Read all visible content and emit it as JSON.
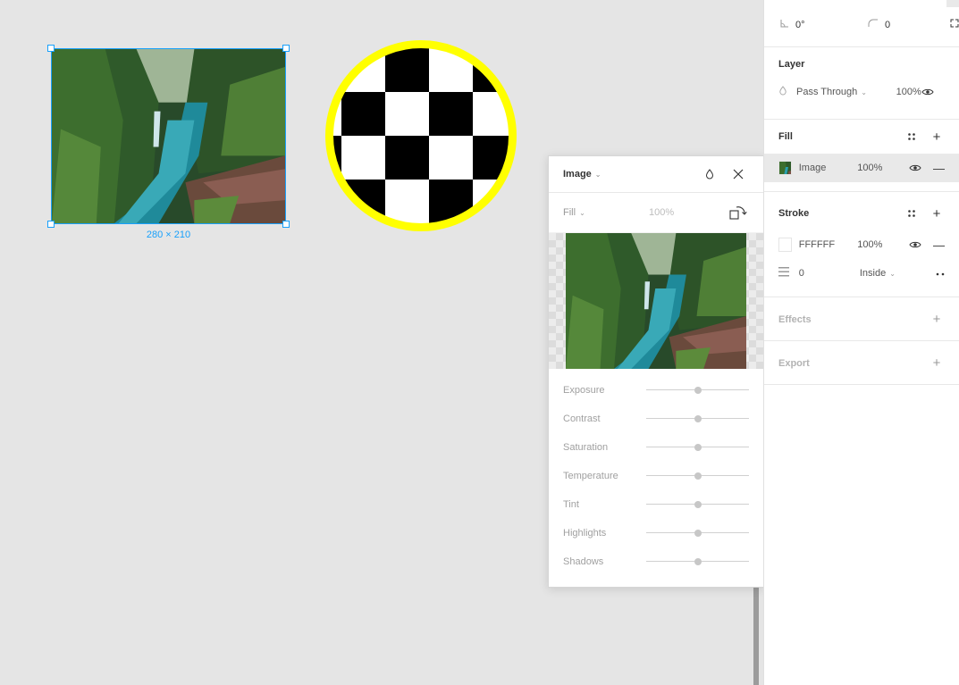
{
  "canvas": {
    "selection_dimensions": "280 × 210",
    "colors": {
      "selection": "#18a0fb",
      "circle_stroke": "#ffff00",
      "canvas_bg": "#e5e5e5"
    }
  },
  "image_popover": {
    "title": "Image",
    "fill_mode": "Fill",
    "opacity": "100%",
    "icons": [
      "chevron-down-icon",
      "drop-icon",
      "close-icon",
      "rotate-icon"
    ],
    "adjustments": [
      {
        "label": "Exposure",
        "value": 0
      },
      {
        "label": "Contrast",
        "value": 0
      },
      {
        "label": "Saturation",
        "value": 0
      },
      {
        "label": "Temperature",
        "value": 0
      },
      {
        "label": "Tint",
        "value": 0
      },
      {
        "label": "Highlights",
        "value": 0
      },
      {
        "label": "Shadows",
        "value": 0
      }
    ]
  },
  "panel": {
    "rotation": "0°",
    "corner_radius": "0",
    "layer": {
      "title": "Layer",
      "blend_mode": "Pass Through",
      "opacity": "100%"
    },
    "fill": {
      "title": "Fill",
      "type": "Image",
      "opacity": "100%"
    },
    "stroke": {
      "title": "Stroke",
      "color": "FFFFFF",
      "opacity": "100%",
      "weight": "0",
      "position": "Inside"
    },
    "effects": {
      "title": "Effects"
    },
    "export": {
      "title": "Export"
    }
  }
}
